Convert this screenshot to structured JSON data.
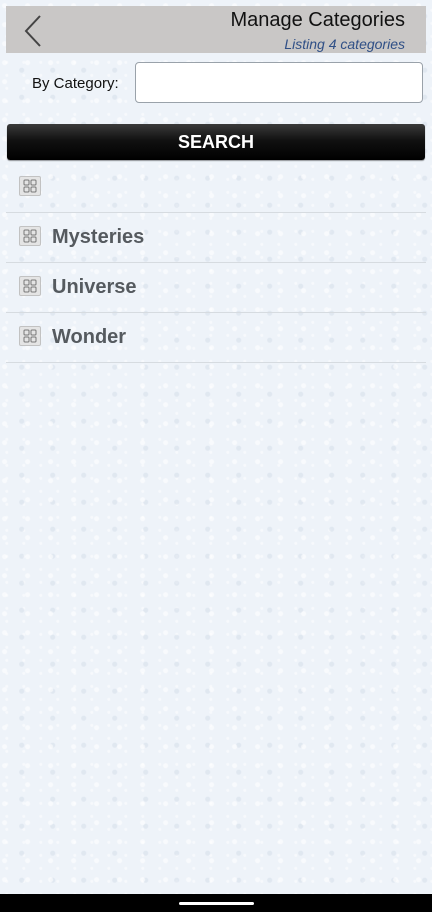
{
  "header": {
    "title": "Manage Categories",
    "subtitle": "Listing 4 categories",
    "back_icon": "chevron-left-icon"
  },
  "filter": {
    "label": "By Category:",
    "value": "",
    "placeholder": ""
  },
  "search_button": {
    "label": "SEARCH"
  },
  "categories": [
    {
      "label": "",
      "icon": "category-icon"
    },
    {
      "label": "Mysteries",
      "icon": "category-icon"
    },
    {
      "label": "Universe",
      "icon": "category-icon"
    },
    {
      "label": "Wonder",
      "icon": "category-icon"
    }
  ],
  "colors": {
    "header_bg": "#c9c7c6",
    "subtitle": "#2f4f86",
    "button_bg": "#000000",
    "category_text": "#555a5f",
    "background": "#eef3f9"
  }
}
